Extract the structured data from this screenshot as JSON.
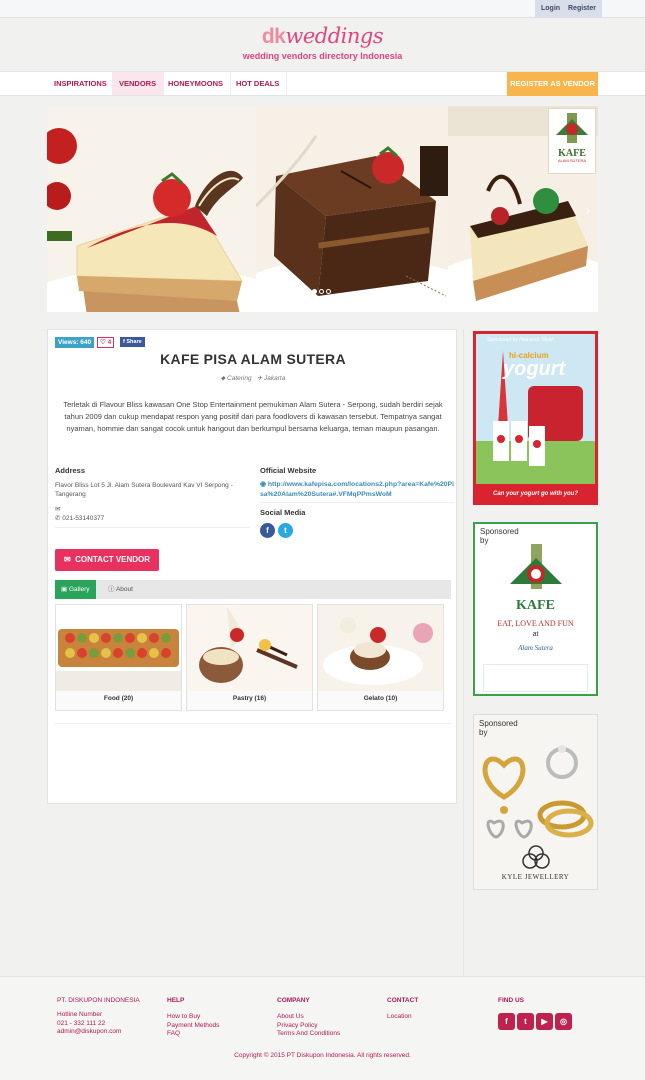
{
  "topbar": {
    "login": "Login",
    "register": "Register"
  },
  "brand": {
    "logo_prefix": "dk",
    "logo_text": "weddings",
    "tagline": "wedding vendors directory Indonesia"
  },
  "nav": {
    "items": [
      {
        "label": "INSPIRATIONS"
      },
      {
        "label": "VENDORS"
      },
      {
        "label": "HONEYMOONS"
      },
      {
        "label": "HOT DEALS"
      }
    ],
    "register_vendor": "REGISTER AS VENDOR"
  },
  "carousel": {
    "active_slide": 1,
    "slide_count": 3,
    "sponsor_logo": "KAFE",
    "sponsor_caption": "ALAM SUTERA"
  },
  "vendor": {
    "views": "Views: 640",
    "likes": "4",
    "share": "Share",
    "name": "KAFE PISA ALAM SUTERA",
    "category": "Catering",
    "city": "Jakarta",
    "description": "Terletak di Flavour Bliss kawasan One Stop Entertainment pemukiman Alam Sutera - Serpong, sudah berdiri sejak tahun 2009 dan cukup mendapat respon yang positif dari para foodlovers di kawasan tersebut. Tempatnya sangat nyaman, hommie dan sangat cocok untuk hangout dan berkumpul bersama keluarga, teman maupun pasangan.",
    "address_label": "Address",
    "address": "Flavor Bliss Lot 5 Jl. Alam Sutera Boulevard Kav VI Serpong - Tangerang",
    "phone": "021-53140377",
    "website_label": "Official Website",
    "website": "http://www.kafepisa.com/locations2.php?area=Kafe%20Pisa%20Alam%20Sutera#.VFMqPPmsWoM",
    "social_label": "Social Media",
    "contact_button": "CONTACT VENDOR"
  },
  "tabs": [
    {
      "label": "Gallery"
    },
    {
      "label": "About"
    }
  ],
  "gallery": [
    {
      "caption": "Food (20)"
    },
    {
      "caption": "Pastry (16)"
    },
    {
      "caption": "Gelato (10)"
    }
  ],
  "ads": {
    "ad1_top": "Sponsored by Heavenly Blush",
    "ad1_brand": "hi-calcium",
    "ad1_product": "yogurt",
    "ad1_tag": "Can your yogurt go with you?",
    "ad2_sponsored": "Sponsored",
    "ad2_by": "by",
    "ad2_brand": "KAFE",
    "ad2_slogan": "EAT, LOVE AND FUN",
    "ad2_at": "at",
    "ad2_place": "Alam Sutera",
    "ad3_sponsored": "Sponsored",
    "ad3_by": "by",
    "ad3_brand": "KYLE JEWELLERY"
  },
  "footer": {
    "company_name": "PT. DISKUPON INDONESIA",
    "hotline_label": "Hotline Number",
    "hotline": "021 - 332 111 22",
    "email": "admin@diskupon.com",
    "help": {
      "title": "HELP",
      "links": [
        "How to Buy",
        "Payment Methods",
        "FAQ"
      ]
    },
    "company": {
      "title": "COMPANY",
      "links": [
        "About Us",
        "Privacy Policy",
        "Terms And Conditions"
      ]
    },
    "contact": {
      "title": "CONTACT",
      "links": [
        "Location"
      ]
    },
    "findus": {
      "title": "FIND US"
    },
    "copyright": "Copyright © 2015 PT Diskupon Indonesia. All rights reserved."
  },
  "colors": {
    "brand": "#e0467a",
    "nav_text": "#b01a52",
    "accent_orange": "#f8b54c",
    "contact_red": "#e8315f",
    "gallery_green": "#2aa35b",
    "views_blue": "#3ea2c6"
  }
}
